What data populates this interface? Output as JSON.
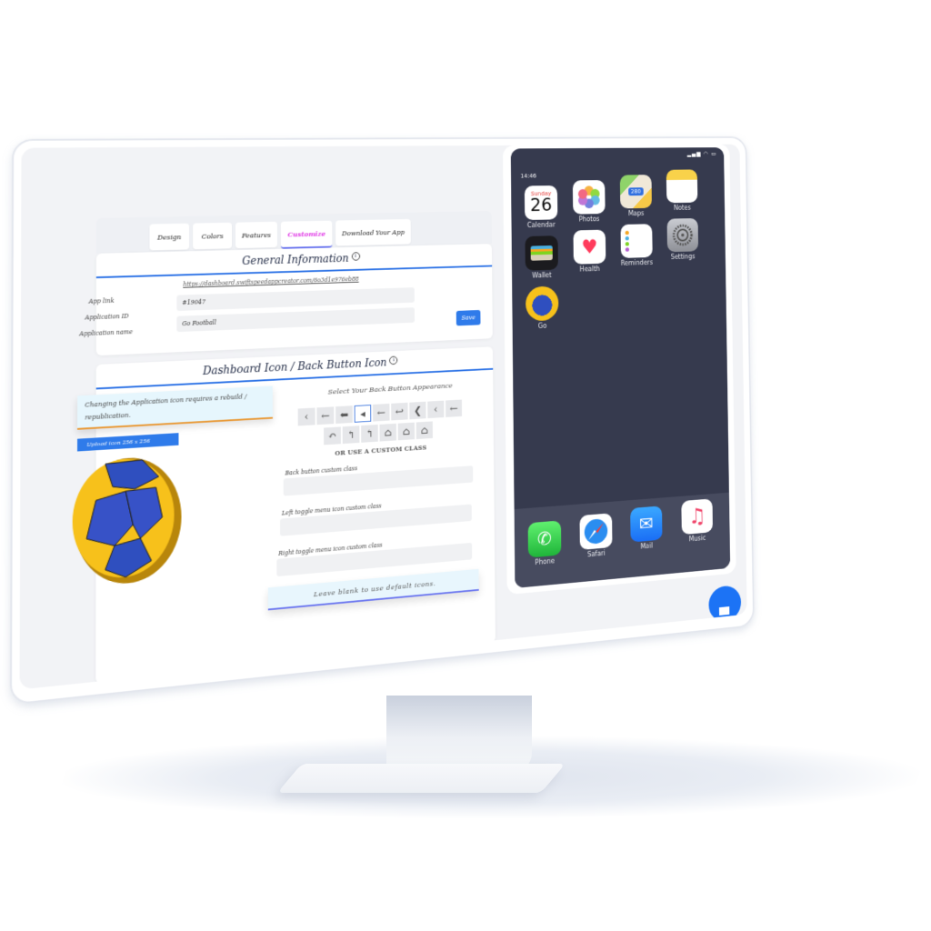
{
  "tabs": [
    {
      "label": "Design",
      "active": false
    },
    {
      "label": "Colors",
      "active": false
    },
    {
      "label": "Features",
      "active": false
    },
    {
      "label": "Customize",
      "active": true
    },
    {
      "label": "Download Your App",
      "active": false
    }
  ],
  "general_info": {
    "title": "General Information",
    "info_icon": "i",
    "app_link_label": "App link",
    "app_link_value": "https://dashboard.swiftspeedappcreator.com/6o3d1e976eb88",
    "application_id_label": "Application ID",
    "application_id_value": "#19047",
    "application_name_label": "Application name",
    "application_name_value": "Go Football",
    "save_label": "Save"
  },
  "dashboard_icon": {
    "title": "Dashboard Icon / Back Button Icon",
    "info_icon": "i",
    "notice": "Changing the Application icon requires a rebuild / republication.",
    "upload_label": "Upload icon 256 x 256",
    "back_button_heading": "Select Your Back Button Appearance",
    "back_icons_row1": [
      "‹",
      "←",
      "⬅",
      "◂",
      "←",
      "↩",
      "❮",
      "‹",
      "←"
    ],
    "back_icons_row2": [
      "↶",
      "↰",
      "↰",
      "⌂",
      "⌂",
      "⌂"
    ],
    "selected_index": 3,
    "custom_class_heading": "OR USE A CUSTOM CLASS",
    "back_button_class_label": "Back button custom class",
    "back_button_class_value": "",
    "left_toggle_label": "Left toggle menu icon custom class",
    "left_toggle_value": "",
    "right_toggle_label": "Right toggle menu icon custom class",
    "right_toggle_value": "",
    "blank_note": "Leave blank to use default icons."
  },
  "phone": {
    "time": "14:46",
    "status_icons": "signal wifi battery",
    "apps": [
      {
        "name": "Calendar",
        "day": "Sunday",
        "date": "26"
      },
      {
        "name": "Photos"
      },
      {
        "name": "Maps",
        "badge": "280"
      },
      {
        "name": "Notes"
      },
      {
        "name": "Wallet"
      },
      {
        "name": "Health"
      },
      {
        "name": "Reminders"
      },
      {
        "name": "Settings"
      },
      {
        "name": "Go"
      }
    ],
    "page_dots": 3,
    "active_dot": 0,
    "dock": [
      {
        "name": "Phone"
      },
      {
        "name": "Safari"
      },
      {
        "name": "Mail"
      },
      {
        "name": "Music"
      }
    ]
  },
  "colors": {
    "accent": "#2f7bea",
    "active_tab": "#e03ae6",
    "phone_bg": "#363a4e",
    "notice_border": "#e99b3a"
  }
}
